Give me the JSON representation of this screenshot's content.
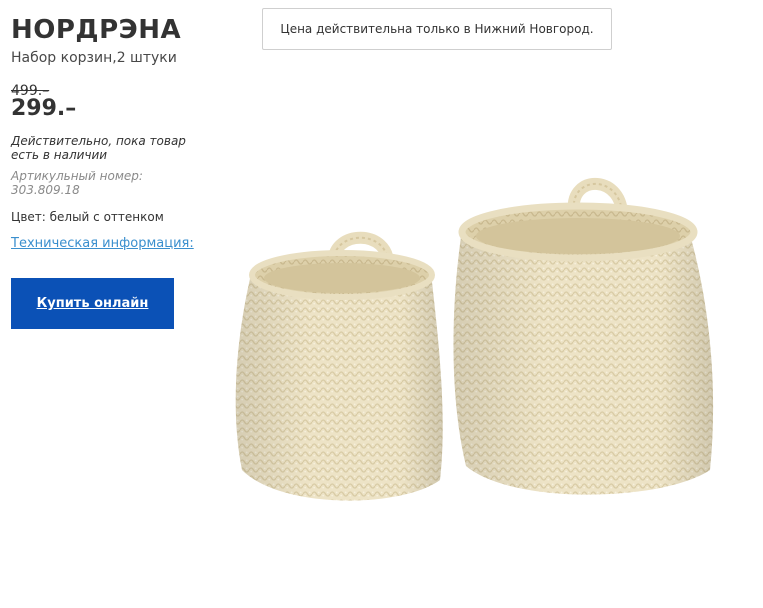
{
  "product": {
    "name": "НОРДРЭНА",
    "description": "Набор корзин,2 штуки",
    "old_price": "499.–",
    "new_price": "299.–",
    "availability": "Действительно, пока товар есть в наличии",
    "article": "Артикульный номер: 303.809.18",
    "color": "Цвет: белый с оттенком",
    "tech_info_label": "Техническая информация:",
    "buy_label": "Купить онлайн"
  },
  "notice": {
    "text": "Цена действительна только в Нижний Новгород."
  },
  "image": {
    "subject": "two-crocheted-baskets",
    "color": "#efe6cc"
  },
  "colors": {
    "buy_button": "#0b51b6",
    "link": "#3a8fce"
  }
}
